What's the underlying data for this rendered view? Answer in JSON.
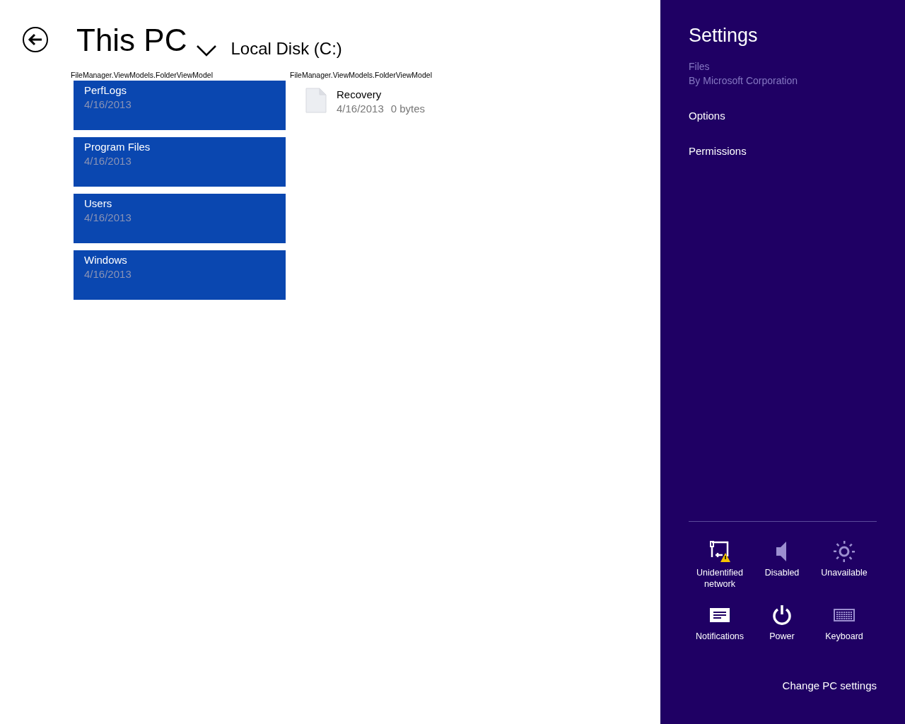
{
  "header": {
    "title": "This PC",
    "location": "Local Disk (C:)"
  },
  "groups": [
    {
      "caption": "FileManager.ViewModels.FolderViewModel",
      "items": [
        {
          "kind": "folder",
          "name": "PerfLogs",
          "date": "4/16/2013"
        },
        {
          "kind": "folder",
          "name": "Program Files",
          "date": "4/16/2013"
        },
        {
          "kind": "folder",
          "name": "Users",
          "date": "4/16/2013"
        },
        {
          "kind": "folder",
          "name": "Windows",
          "date": "4/16/2013"
        }
      ]
    },
    {
      "caption": "FileManager.ViewModels.FolderViewModel",
      "items": [
        {
          "kind": "file",
          "name": "Recovery",
          "date": "4/16/2013",
          "size": "0 bytes"
        }
      ]
    }
  ],
  "settings": {
    "title": "Settings",
    "app_name": "Files",
    "publisher": "By Microsoft Corporation",
    "links": [
      "Options",
      "Permissions"
    ],
    "quick_actions": [
      {
        "kind": "network",
        "label": "Unidentified network",
        "disabled": false
      },
      {
        "kind": "volume",
        "label": "Disabled",
        "disabled": true
      },
      {
        "kind": "brightness",
        "label": "Unavailable",
        "disabled": true
      },
      {
        "kind": "notifications",
        "label": "Notifications",
        "disabled": false
      },
      {
        "kind": "power",
        "label": "Power",
        "disabled": false
      },
      {
        "kind": "keyboard",
        "label": "Keyboard",
        "disabled": true
      }
    ],
    "footer_link": "Change PC settings"
  }
}
